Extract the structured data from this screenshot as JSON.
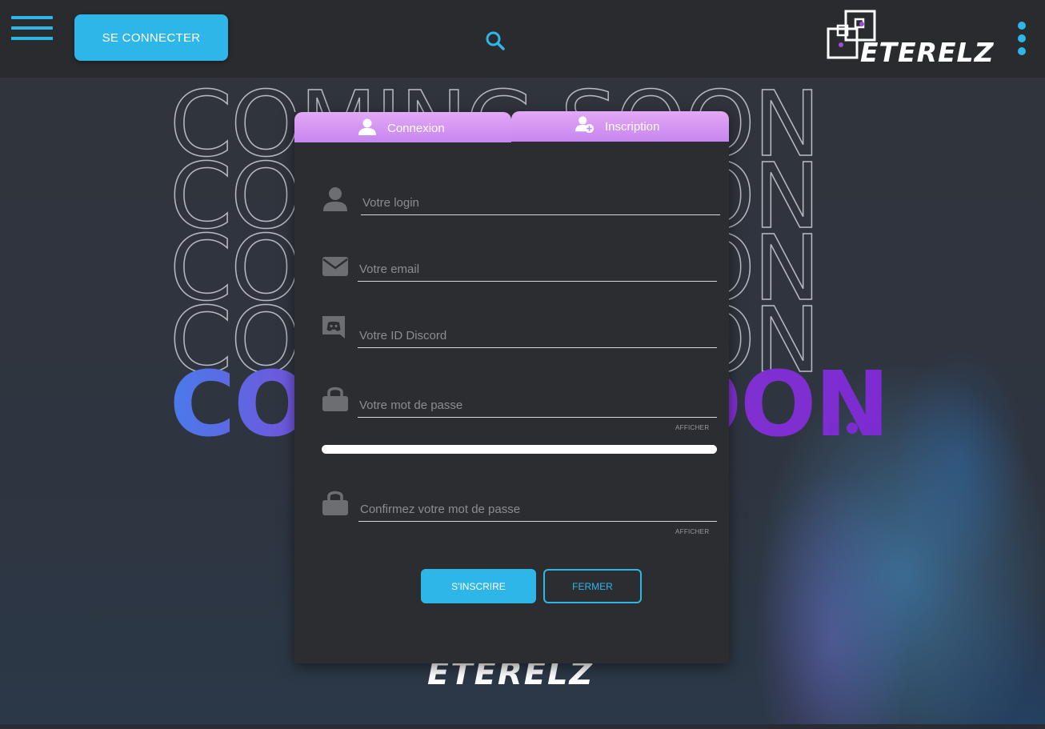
{
  "header": {
    "connect_label": "SE CONNECTER",
    "logo_text": "ETERELZ"
  },
  "background": {
    "headline": "COMING SOON",
    "headline_suffix": "...",
    "bottom_logo": "ETERELZ"
  },
  "modal": {
    "tabs": [
      {
        "label": "Connexion",
        "icon": "user-icon"
      },
      {
        "label": "Inscription",
        "icon": "user-add-icon"
      }
    ],
    "fields": {
      "login": {
        "placeholder": "Votre login",
        "value": ""
      },
      "email": {
        "placeholder": "Votre email",
        "value": ""
      },
      "discord": {
        "placeholder": "Votre ID Discord",
        "value": ""
      },
      "password": {
        "placeholder": "Votre mot de passe",
        "value": ""
      },
      "password_confirm": {
        "placeholder": "Confirmez votre mot de passe",
        "value": ""
      }
    },
    "show_label": "AFFICHER",
    "signup_label": "S'INSCRIRE",
    "close_label": "FERMER"
  },
  "colors": {
    "accent": "#2fb6e8",
    "tab_gradient_top": "#e3a8f5",
    "tab_gradient_bottom": "#c686f0",
    "modal_bg": "#2c2d30",
    "header_bg": "#2a2b2f",
    "headline_gradient": [
      "#4a7bea",
      "#7c2bd1"
    ]
  }
}
